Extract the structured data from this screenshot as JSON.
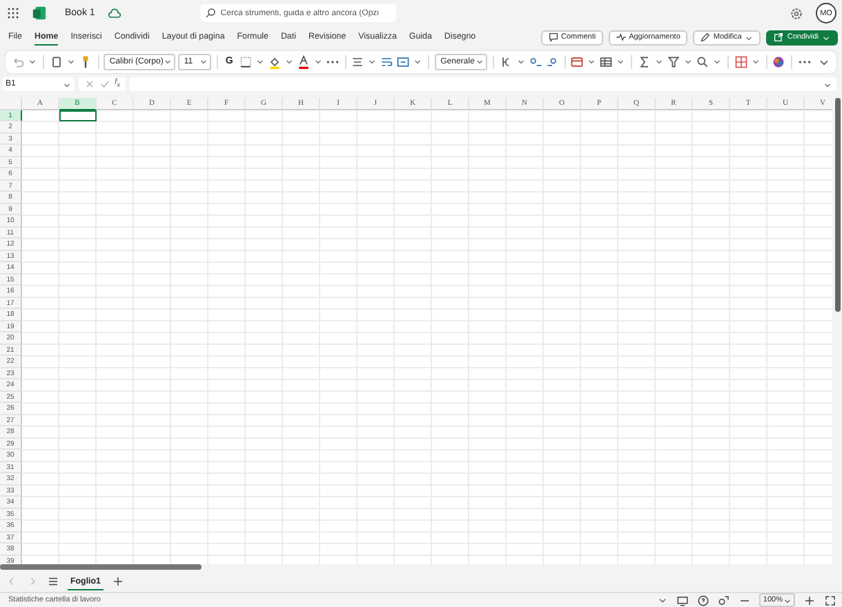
{
  "app": {
    "title": "Book 1",
    "search": {
      "placeholder": "Cerca strumenti, guida e altro ancora (Opzi"
    },
    "avatar": "MO"
  },
  "ribbon_tabs": [
    {
      "label": "File",
      "selected": false
    },
    {
      "label": "Home",
      "selected": true
    },
    {
      "label": "Inserisci",
      "selected": false
    },
    {
      "label": "Condividi",
      "selected": false
    },
    {
      "label": "Layout di pagina",
      "selected": false
    },
    {
      "label": "Formule",
      "selected": false
    },
    {
      "label": "Dati",
      "selected": false
    },
    {
      "label": "Revisione",
      "selected": false
    },
    {
      "label": "Visualizza",
      "selected": false
    },
    {
      "label": "Guida",
      "selected": false
    },
    {
      "label": "Disegno",
      "selected": false
    }
  ],
  "ribbon_actions": [
    {
      "label": "Commenti",
      "kind": "comments"
    },
    {
      "label": "Aggiornamento",
      "kind": "activity"
    },
    {
      "label": "Modifica",
      "kind": "edit"
    },
    {
      "label": "Condividi",
      "kind": "share"
    }
  ],
  "toolbar": {
    "font": "Calibri (Corpo)",
    "font_size": "11",
    "bold": "G",
    "number_format": "Generale"
  },
  "formula_bar": {
    "name_box": "B1",
    "function_label": "f$_{x}$"
  },
  "sheet": {
    "columns": [
      {
        "label": "A",
        "selected": false
      },
      {
        "label": "B",
        "selected": true
      },
      {
        "label": "C",
        "selected": false
      },
      {
        "label": "D",
        "selected": false
      },
      {
        "label": "E",
        "selected": false
      },
      {
        "label": "F",
        "selected": false
      },
      {
        "label": "G",
        "selected": false
      },
      {
        "label": "H",
        "selected": false
      },
      {
        "label": "I",
        "selected": false
      },
      {
        "label": "J",
        "selected": false
      },
      {
        "label": "K",
        "selected": false
      },
      {
        "label": "L",
        "selected": false
      },
      {
        "label": "M",
        "selected": false
      },
      {
        "label": "N",
        "selected": false
      },
      {
        "label": "O",
        "selected": false
      },
      {
        "label": "P",
        "selected": false
      },
      {
        "label": "Q",
        "selected": false
      },
      {
        "label": "R",
        "selected": false
      },
      {
        "label": "S",
        "selected": false
      },
      {
        "label": "T",
        "selected": false
      },
      {
        "label": "U",
        "selected": false
      },
      {
        "label": "V",
        "selected": false
      }
    ],
    "rows": [
      {
        "label": "1",
        "selected": true
      },
      {
        "label": "2",
        "selected": false
      },
      {
        "label": "3",
        "selected": false
      },
      {
        "label": "4",
        "selected": false
      },
      {
        "label": "5",
        "selected": false
      },
      {
        "label": "6",
        "selected": false
      },
      {
        "label": "7",
        "selected": false
      },
      {
        "label": "8",
        "selected": false
      },
      {
        "label": "9",
        "selected": false
      },
      {
        "label": "10",
        "selected": false
      },
      {
        "label": "11",
        "selected": false
      },
      {
        "label": "12",
        "selected": false
      },
      {
        "label": "13",
        "selected": false
      },
      {
        "label": "14",
        "selected": false
      },
      {
        "label": "15",
        "selected": false
      },
      {
        "label": "16",
        "selected": false
      },
      {
        "label": "17",
        "selected": false
      },
      {
        "label": "18",
        "selected": false
      },
      {
        "label": "19",
        "selected": false
      },
      {
        "label": "20",
        "selected": false
      },
      {
        "label": "21",
        "selected": false
      },
      {
        "label": "22",
        "selected": false
      },
      {
        "label": "23",
        "selected": false
      },
      {
        "label": "24",
        "selected": false
      },
      {
        "label": "25",
        "selected": false
      },
      {
        "label": "26",
        "selected": false
      },
      {
        "label": "27",
        "selected": false
      },
      {
        "label": "28",
        "selected": false
      },
      {
        "label": "29",
        "selected": false
      },
      {
        "label": "30",
        "selected": false
      },
      {
        "label": "31",
        "selected": false
      },
      {
        "label": "32",
        "selected": false
      },
      {
        "label": "33",
        "selected": false
      },
      {
        "label": "34",
        "selected": false
      },
      {
        "label": "35",
        "selected": false
      },
      {
        "label": "36",
        "selected": false
      },
      {
        "label": "37",
        "selected": false
      },
      {
        "label": "38",
        "selected": false
      },
      {
        "label": "39",
        "selected": false
      }
    ]
  },
  "sheet_tabs": [
    {
      "label": "Foglio1",
      "selected": true
    }
  ],
  "status_bar": {
    "text": "Statistiche cartella di lavoro",
    "zoom": "100%"
  }
}
